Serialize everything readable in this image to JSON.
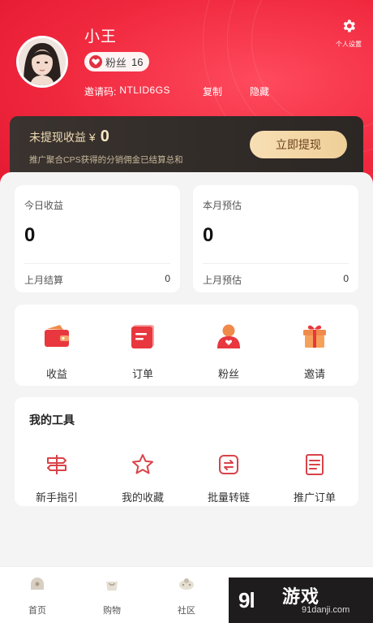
{
  "profile": {
    "username": "小王",
    "fans_label": "粉丝",
    "fans_count": "16",
    "invite_label": "邀请码:",
    "invite_code": "NTLID6GS",
    "copy_label": "复制",
    "hide_label": "隐藏",
    "settings_label": "个人设置"
  },
  "earnings": {
    "title": "未提现收益 ¥",
    "amount": "0",
    "subtitle": "推广聚合CPS获得的分销佣金已结算总和",
    "withdraw_label": "立即提现"
  },
  "stats": [
    {
      "title": "今日收益",
      "value": "0",
      "bottom_label": "上月结算",
      "bottom_value": "0"
    },
    {
      "title": "本月预估",
      "value": "0",
      "bottom_label": "上月预估",
      "bottom_value": "0"
    }
  ],
  "quick_actions": [
    {
      "label": "收益",
      "icon": "wallet-icon"
    },
    {
      "label": "订单",
      "icon": "order-icon"
    },
    {
      "label": "粉丝",
      "icon": "fans-icon"
    },
    {
      "label": "邀请",
      "icon": "gift-icon"
    }
  ],
  "tools": {
    "title": "我的工具",
    "items": [
      {
        "label": "新手指引",
        "icon": "signpost-icon"
      },
      {
        "label": "我的收藏",
        "icon": "star-icon"
      },
      {
        "label": "批量转链",
        "icon": "convert-icon"
      },
      {
        "label": "推广订单",
        "icon": "document-icon"
      }
    ]
  },
  "tabbar": [
    {
      "label": "首页",
      "icon": "home-icon"
    },
    {
      "label": "购物",
      "icon": "shopping-bag-icon"
    },
    {
      "label": "社区",
      "icon": "community-icon"
    }
  ],
  "watermark": {
    "logo": "9l",
    "text": "游戏",
    "url": "91danji.com"
  },
  "colors": {
    "brand_red": "#f0283e",
    "dark_card": "#2f2a27",
    "gold": "#f1d3a0"
  }
}
